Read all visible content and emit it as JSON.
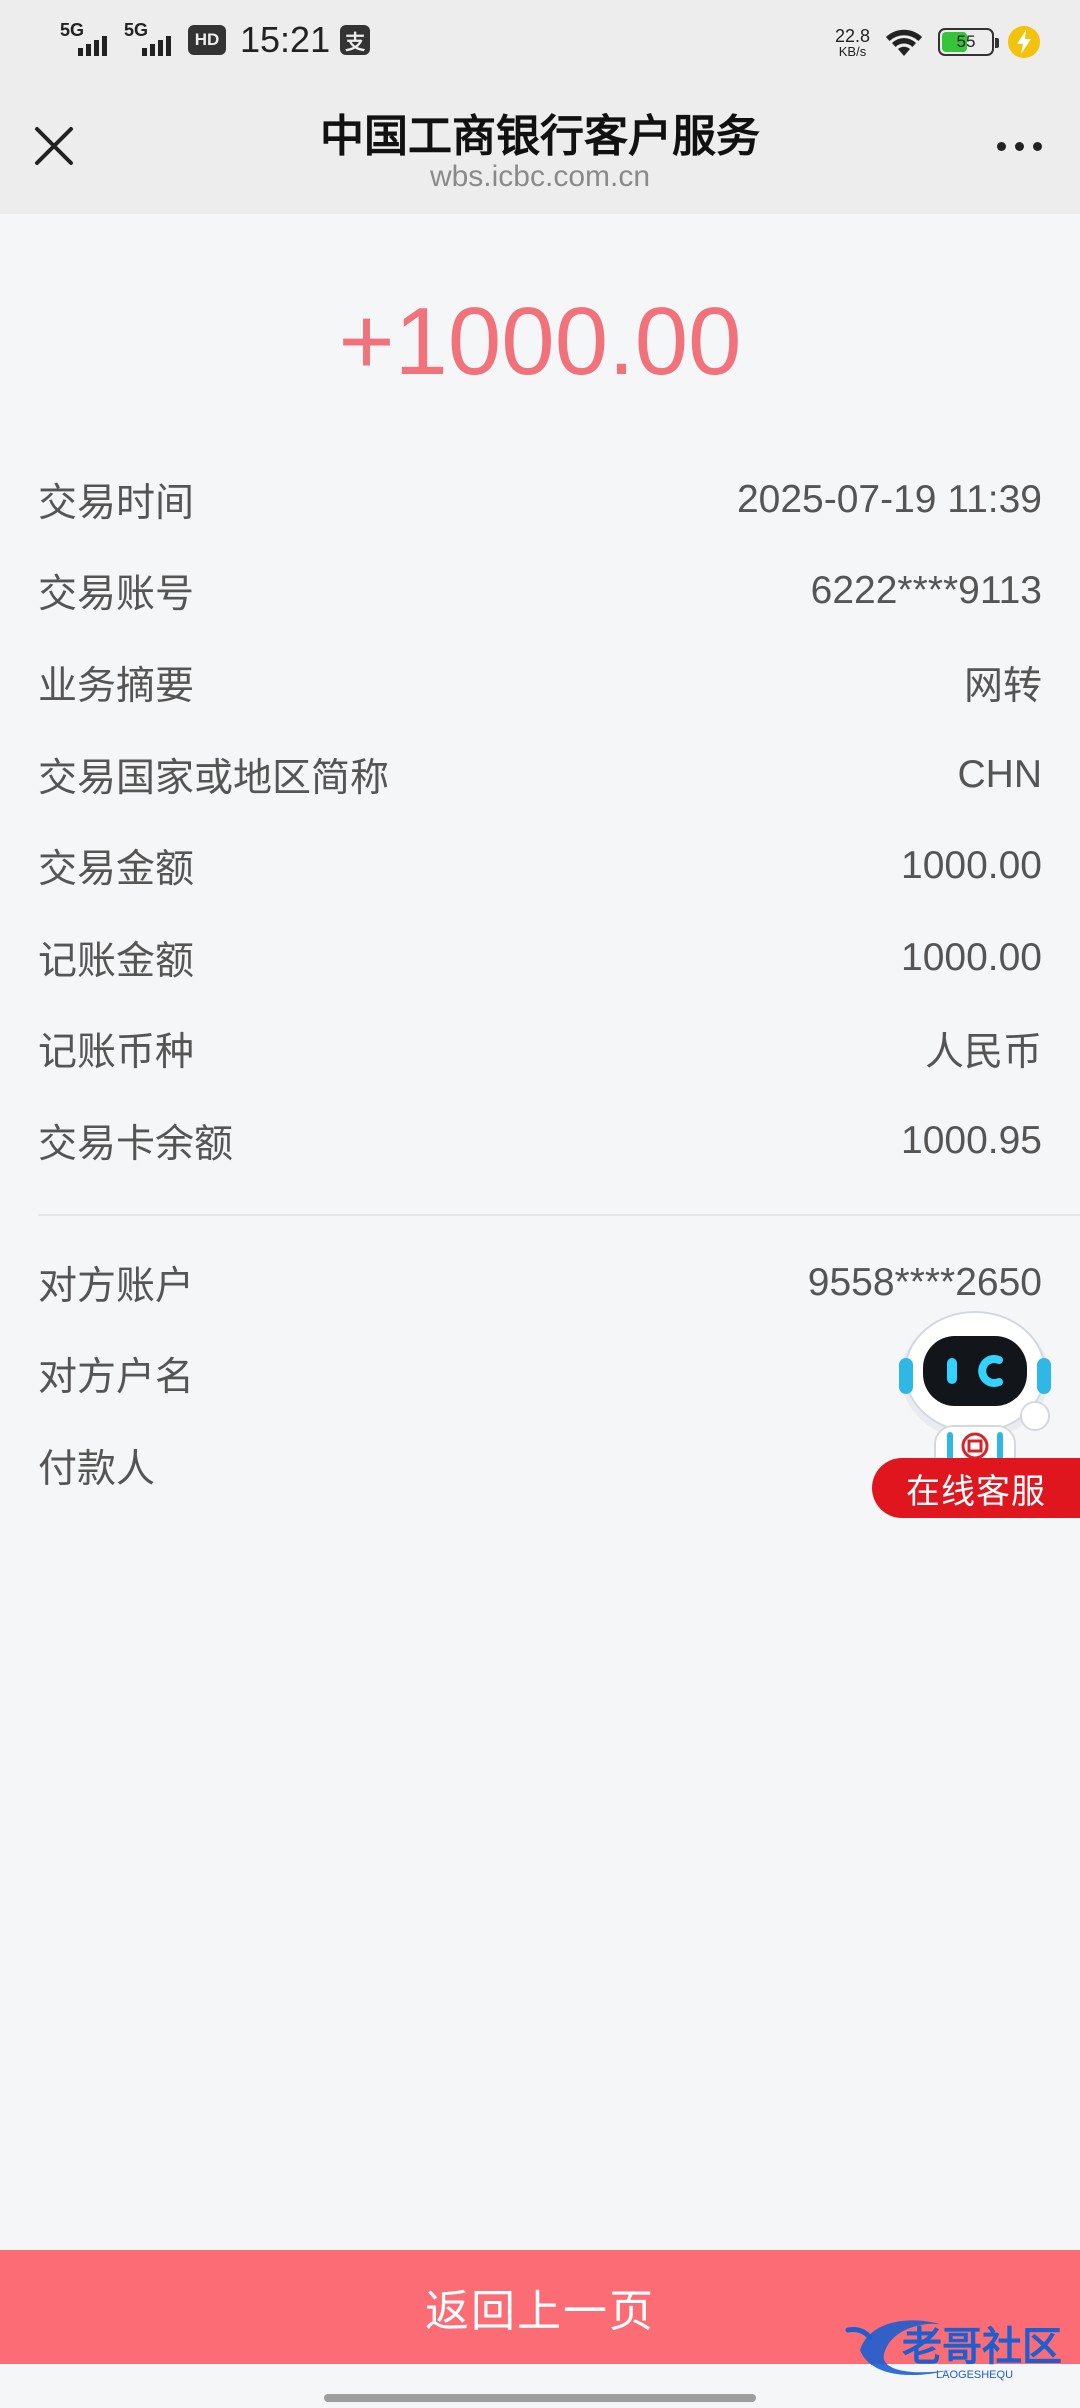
{
  "status_bar": {
    "network_1": "5G",
    "network_2": "5G",
    "hd_badge": "HD",
    "time": "15:21",
    "alipay_icon": "支",
    "net_speed_value": "22.8",
    "net_speed_unit": "KB/s",
    "battery_level": "55",
    "battery_fraction": 0.55,
    "battery_color": "#35c43a",
    "charging_color": "#f3c20d"
  },
  "nav": {
    "title": "中国工商银行客户服务",
    "url": "wbs.icbc.com.cn",
    "close_icon": "close-icon",
    "more_icon": "more-dots-icon"
  },
  "transaction": {
    "amount": "+1000.00",
    "amount_color": "#f2727b",
    "details": [
      {
        "label": "交易时间",
        "value": "2025-07-19 11:39"
      },
      {
        "label": "交易账号",
        "value": "6222****9113"
      },
      {
        "label": "业务摘要",
        "value": "网转"
      },
      {
        "label": "交易国家或地区简称",
        "value": "CHN"
      },
      {
        "label": "交易金额",
        "value": "1000.00"
      },
      {
        "label": "记账金额",
        "value": "1000.00"
      },
      {
        "label": "记账币种",
        "value": "人民币"
      },
      {
        "label": "交易卡余额",
        "value": "1000.95"
      }
    ],
    "counterparty": [
      {
        "label": "对方账户",
        "value": "9558****2650"
      },
      {
        "label": "对方户名",
        "value": ""
      },
      {
        "label": "付款人",
        "value": ""
      }
    ]
  },
  "service": {
    "label": "在线客服",
    "color": "#e0161e"
  },
  "footer": {
    "back_label": "返回上一页",
    "button_color": "#fb6c74"
  },
  "watermark": {
    "text": "老哥社区",
    "subtext": "LAOGESHEQU"
  }
}
